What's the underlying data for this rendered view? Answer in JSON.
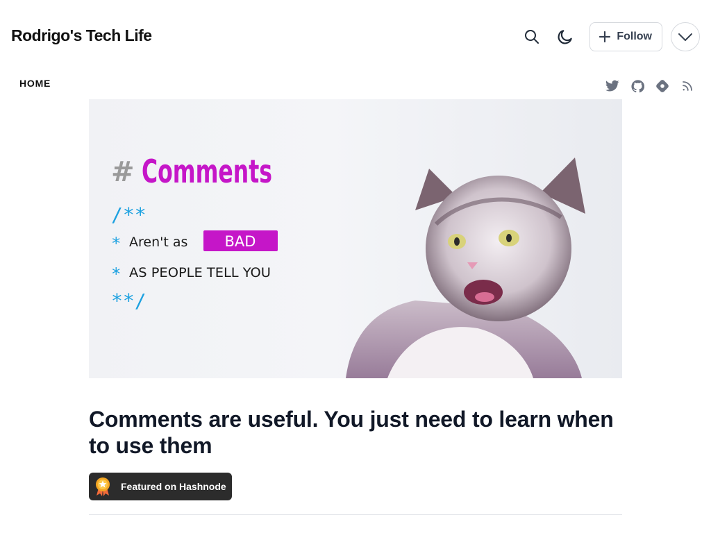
{
  "site": {
    "title": "Rodrigo's Tech Life"
  },
  "header": {
    "follow_label": "Follow",
    "icons": [
      "search-icon",
      "moon-icon",
      "plus-icon",
      "chevron-down-icon"
    ]
  },
  "nav": {
    "home_label": "HOME"
  },
  "socials": [
    "twitter-icon",
    "github-icon",
    "hashnode-icon",
    "rss-icon"
  ],
  "cover": {
    "heading_prefix": "#",
    "heading": "Comments",
    "line1": "/**",
    "line2_star": "*",
    "line2_text": "Aren't as",
    "highlight": "BAD",
    "line3_star": "*",
    "line3_text": "AS PEOPLE TELL YOU",
    "line4": "**/",
    "colors": {
      "accent": "#c516c8",
      "code_blue": "#1da1e0",
      "hash_gray": "#9a9a9a"
    }
  },
  "post": {
    "title": "Comments are useful. You just need to learn when to use them",
    "badge_label": "Featured on Hashnode"
  }
}
